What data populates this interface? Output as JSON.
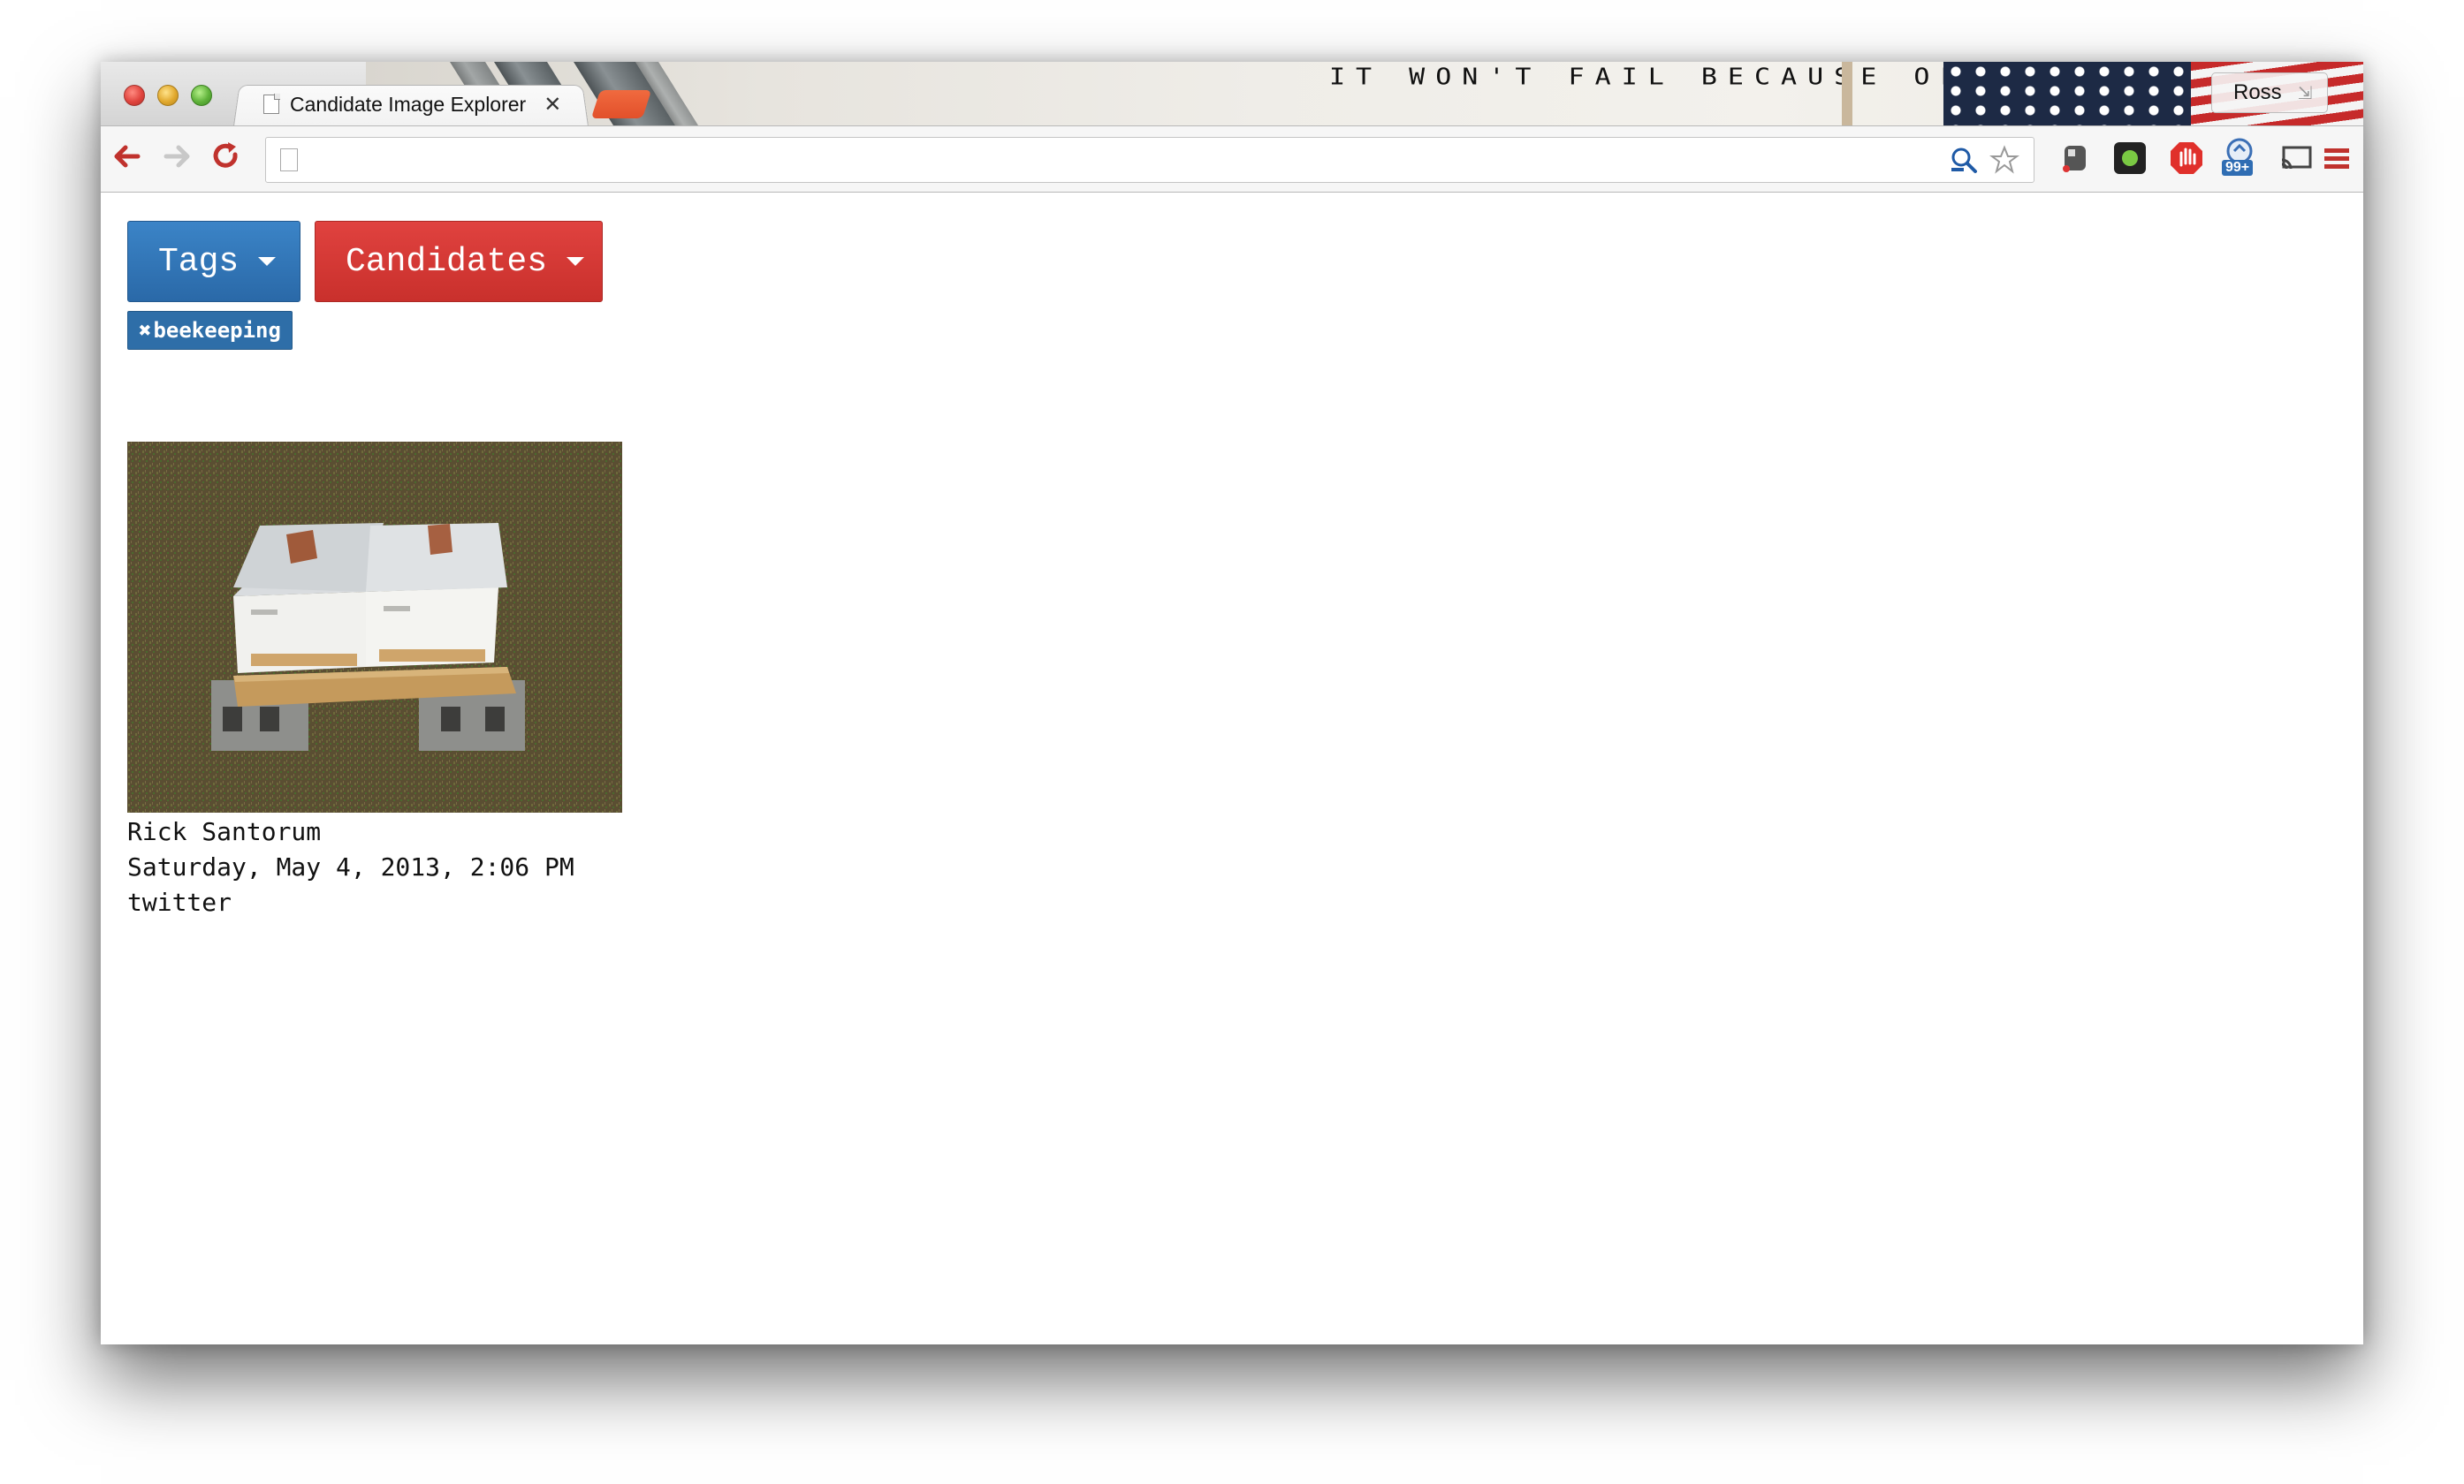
{
  "window": {
    "tab_title": "Candidate Image Explorer",
    "tab_close": "✕",
    "profile_name": "Ross",
    "theme_slogan": "IT WON'T FAIL BECAUSE OF ME"
  },
  "toolbar": {
    "address_value": "",
    "icons": [
      "back-arrow-icon",
      "forward-arrow-icon",
      "reload-icon",
      "search-icon",
      "star-icon",
      "evernote-icon",
      "green-circle-icon",
      "adblock-icon",
      "notifications-icon",
      "cast-icon",
      "menu-icon"
    ],
    "notification_badge": "99+"
  },
  "page": {
    "tags_button": "Tags",
    "candidates_button": "Candidates",
    "active_tag": {
      "remove_glyph": "✖",
      "label": "beekeeping"
    },
    "results": [
      {
        "candidate": "Rick Santorum",
        "date": "Saturday, May 4, 2013, 2:06 PM",
        "source": "twitter",
        "image_subject": "two white beehives on cinder blocks in a grassy field"
      }
    ]
  },
  "colors": {
    "tags_blue": "#2a69a8",
    "candidates_red": "#c9302c",
    "chip_blue": "#2e6ea8"
  }
}
